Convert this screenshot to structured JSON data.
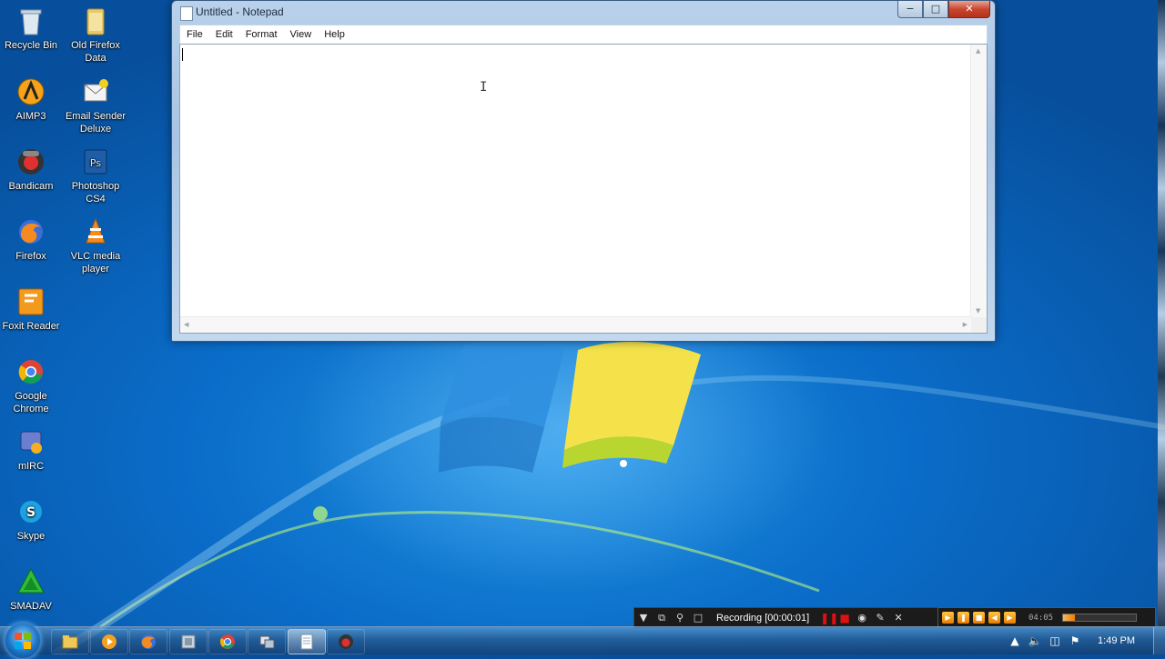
{
  "desktop": {
    "icons": [
      {
        "label": "Recycle Bin"
      },
      {
        "label": "Old Firefox Data"
      },
      {
        "label": "AIMP3"
      },
      {
        "label": "Email Sender Deluxe"
      },
      {
        "label": "Bandicam"
      },
      {
        "label": "Photoshop CS4"
      },
      {
        "label": "Firefox"
      },
      {
        "label": "VLC media player"
      },
      {
        "label": "Foxit Reader"
      },
      {
        "label": "Google Chrome"
      },
      {
        "label": "mIRC"
      },
      {
        "label": "Skype"
      },
      {
        "label": "SMADAV"
      }
    ]
  },
  "window": {
    "title": "Untitled - Notepad",
    "menu": [
      "File",
      "Edit",
      "Format",
      "View",
      "Help"
    ],
    "content": ""
  },
  "recording": {
    "label": "Recording [00:00:01]"
  },
  "player": {
    "time": "04:05",
    "volume_fraction": 0.16
  },
  "taskbar": {
    "clock": "1:49 PM",
    "items": [
      {
        "icon": "explorer-icon"
      },
      {
        "icon": "media-player-icon"
      },
      {
        "icon": "firefox-icon"
      },
      {
        "icon": "app-icon"
      },
      {
        "icon": "chrome-icon"
      },
      {
        "icon": "network-app-icon"
      },
      {
        "icon": "notepad-icon"
      },
      {
        "icon": "bandicam-icon"
      }
    ]
  },
  "colors": {
    "desktop_blue": "#0a6cc8",
    "close_red": "#c84731",
    "rec_red": "#e01010"
  }
}
